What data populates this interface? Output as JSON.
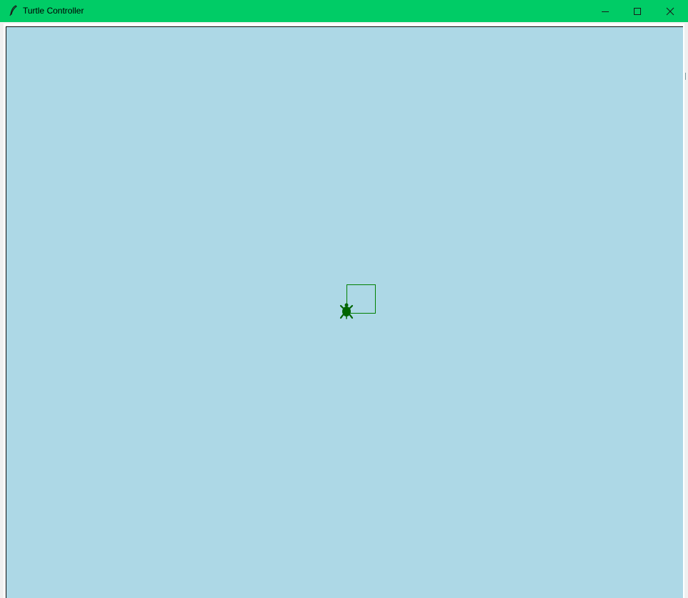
{
  "window": {
    "title": "Turtle Controller",
    "titlebar_color": "#00cc66",
    "app_icon": "feather-icon"
  },
  "caption_buttons": {
    "minimize_icon": "minimize-icon",
    "maximize_icon": "maximize-icon",
    "close_icon": "close-icon"
  },
  "canvas": {
    "background_color": "#add8e6",
    "pen_color": "#008000",
    "turtle_color": "#006400",
    "turtle_icon": "turtle-icon"
  }
}
